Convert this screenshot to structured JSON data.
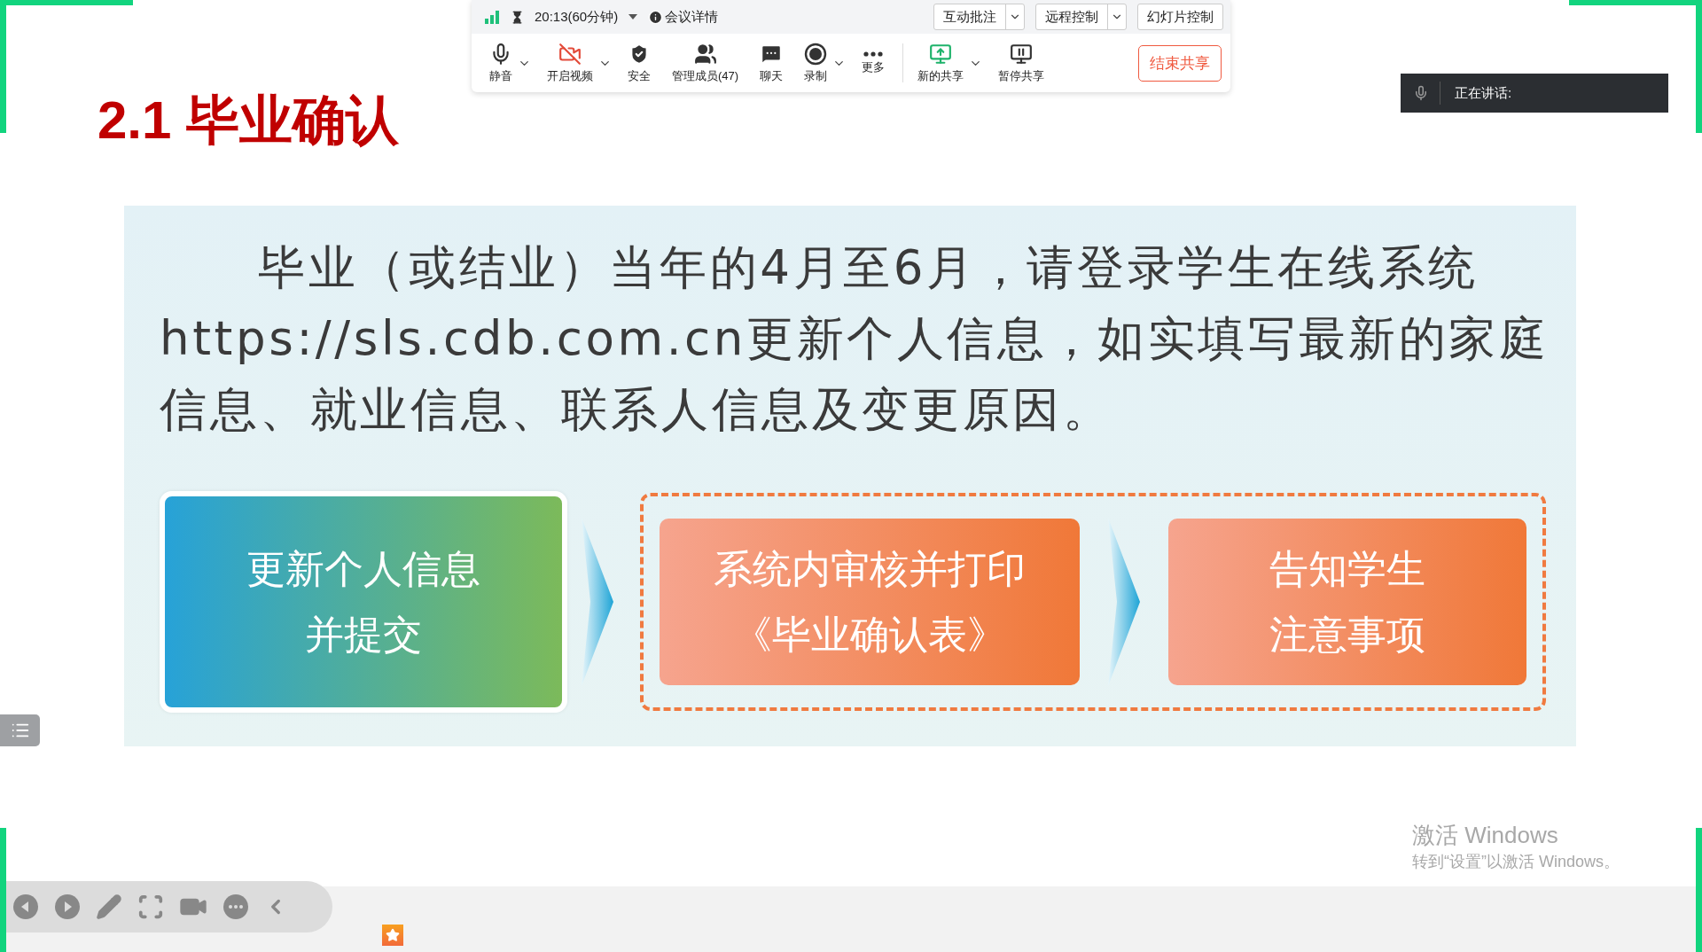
{
  "meeting_toolbar": {
    "timer": "20:13(60分钟)",
    "details": "会议详情",
    "top_buttons": [
      {
        "label": "互动批注",
        "has_menu": true
      },
      {
        "label": "远程控制",
        "has_menu": true
      },
      {
        "label": "幻灯片控制",
        "has_menu": false
      }
    ],
    "tools": [
      {
        "kind": "mic",
        "label": "静音",
        "has_menu": true
      },
      {
        "kind": "video_off",
        "label": "开启视频",
        "has_menu": true
      },
      {
        "kind": "shield",
        "label": "安全",
        "has_menu": false
      },
      {
        "kind": "people",
        "label": "管理成员(47)",
        "has_menu": false
      },
      {
        "kind": "chat",
        "label": "聊天",
        "has_menu": false
      },
      {
        "kind": "record",
        "label": "录制",
        "has_menu": true
      },
      {
        "kind": "more",
        "label": "更多",
        "has_menu": false
      },
      {
        "kind": "share",
        "label": "新的共享",
        "has_menu": true
      },
      {
        "kind": "pause",
        "label": "暂停共享",
        "has_menu": false
      }
    ],
    "end_button": "结束共享"
  },
  "speaker_panel": {
    "label": "正在讲话:"
  },
  "slide": {
    "title": "2.1 毕业确认",
    "paragraph": "毕业（或结业）当年的4月至6月，请登录学生在线系统https://sls.cdb.com.cn更新个人信息，如实填写最新的家庭信息、就业信息、联系人信息及变更原因。",
    "steps": [
      {
        "kind": "teal",
        "grouped": false,
        "lines": [
          "更新个人信息",
          "并提交"
        ]
      },
      {
        "kind": "orange",
        "grouped": true,
        "lines": [
          "系统内审核并打印",
          "《毕业确认表》"
        ]
      },
      {
        "kind": "orange",
        "grouped": true,
        "lines": [
          "告知学生",
          "注意事项"
        ]
      }
    ]
  },
  "activation_notice": {
    "title": "激活 Windows",
    "subtitle": "转到“设置”以激活 Windows。"
  }
}
